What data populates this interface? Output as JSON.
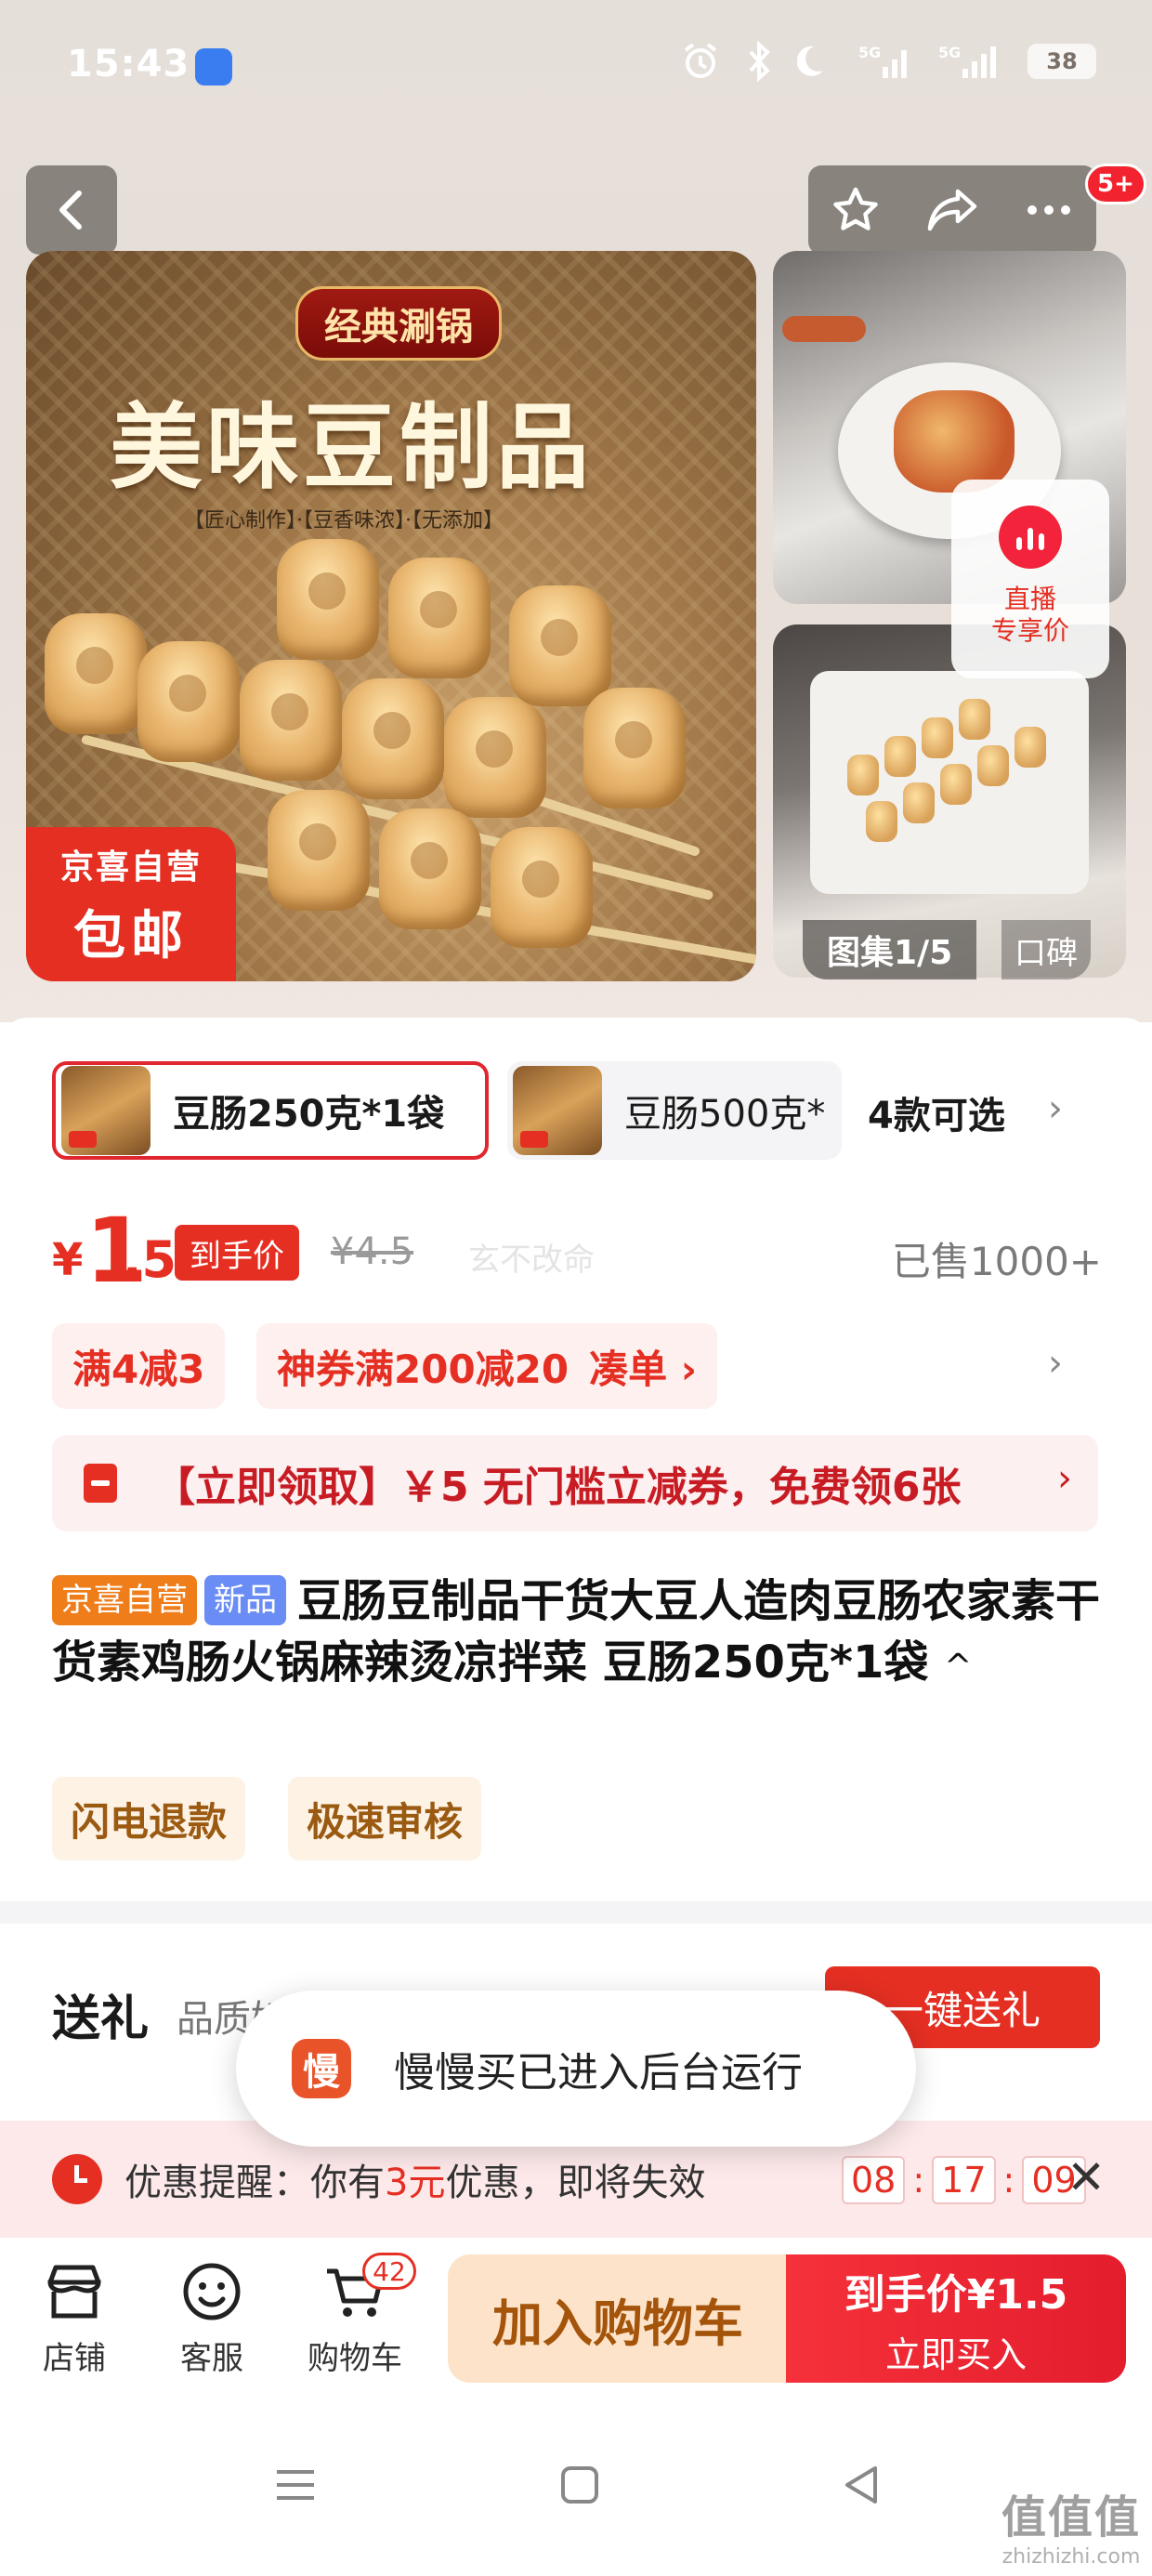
{
  "status_bar": {
    "time": "15:43",
    "battery": "38",
    "icons": [
      "alarm-icon",
      "bluetooth-icon",
      "moon-icon",
      "signal-5g-icon",
      "signal-5g-icon-2"
    ]
  },
  "top_nav": {
    "icons": [
      "back-icon",
      "star-icon",
      "share-icon",
      "more-icon"
    ],
    "more_badge": "5+"
  },
  "gallery": {
    "hero": {
      "banner": "经典涮锅",
      "title": "美味豆制品",
      "tags": "【匠心制作】·【豆香味浓】·【无添加】",
      "badge_line1": "京喜自营",
      "badge_line2": "包邮"
    },
    "live_label_line1": "直播",
    "live_label_line2": "专享价",
    "counter": "图集1/5",
    "reviews_tab": "口碑"
  },
  "variants": {
    "items": [
      "豆肠250克*1袋",
      "豆肠500克*"
    ],
    "count_label": "4款可选"
  },
  "price": {
    "currency": "¥",
    "integer": "1",
    "decimal": ".5",
    "tag": "到手价",
    "original": "¥4.5",
    "watermark": "玄不改命",
    "sold": "已售1000+"
  },
  "promotions": {
    "chip1": "满4减3",
    "chip2": "神券满200减20",
    "chip2_link": "凑单 ›",
    "coupon": "【立即领取】￥5 无门槛立减券，免费领6张"
  },
  "product": {
    "tag_jx": "京喜自营",
    "tag_new": "新品",
    "title": "豆肠豆制品干货大豆人造肉豆肠农家素干货素鸡肠火锅麻辣烫凉拌菜 豆肠250克*1袋",
    "services": [
      "闪电退款",
      "极速审核"
    ]
  },
  "gift": {
    "title": "送礼",
    "subtitle": "品质好物 心意送达",
    "button": "一键送礼"
  },
  "toast": {
    "icon_char": "慢",
    "text": "慢慢买已进入后台运行"
  },
  "reminder": {
    "prefix": "优惠提醒：你有",
    "amount": "3元",
    "suffix": "优惠，即将失效",
    "hh": "08",
    "mm": "17",
    "ss": "09"
  },
  "bottom_bar": {
    "store": "店铺",
    "service": "客服",
    "cart": "购物车",
    "cart_count": "42",
    "add_cart": "加入购物车",
    "buy_price": "到手价¥1.5",
    "buy_label": "立即买入"
  },
  "site_mark": {
    "big": "值值值",
    "small": "zhizhizhi.com"
  },
  "colors": {
    "brand_red": "#e52f23",
    "service_brown": "#9a5a12",
    "jx_orange": "#ef7d1a",
    "new_blue": "#6a8cf5"
  }
}
